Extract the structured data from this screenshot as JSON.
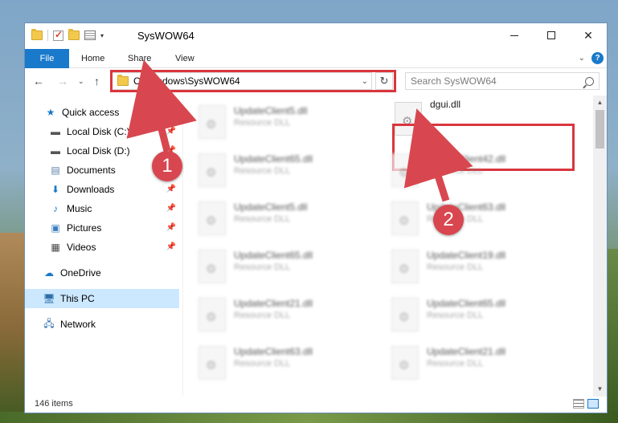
{
  "window": {
    "title": "SysWOW64"
  },
  "ribbon": {
    "tabs": [
      "File",
      "Home",
      "Share",
      "View"
    ]
  },
  "navigation": {
    "address": "C:\\Windows\\SysWOW64",
    "search_placeholder": "Search SysWOW64"
  },
  "sidebar": {
    "items": [
      {
        "label": "Quick access",
        "icon": "star-icon",
        "pinned": false
      },
      {
        "label": "Local Disk (C:)",
        "icon": "drive-icon",
        "pinned": true
      },
      {
        "label": "Local Disk (D:)",
        "icon": "drive-icon",
        "pinned": true
      },
      {
        "label": "Documents",
        "icon": "documents-icon",
        "pinned": true
      },
      {
        "label": "Downloads",
        "icon": "downloads-icon",
        "pinned": true
      },
      {
        "label": "Music",
        "icon": "music-icon",
        "pinned": true
      },
      {
        "label": "Pictures",
        "icon": "pictures-icon",
        "pinned": true
      },
      {
        "label": "Videos",
        "icon": "videos-icon",
        "pinned": true
      },
      {
        "label": "OneDrive",
        "icon": "onedrive-icon",
        "pinned": false
      },
      {
        "label": "This PC",
        "icon": "this-pc-icon",
        "pinned": false,
        "selected": true
      },
      {
        "label": "Network",
        "icon": "network-icon",
        "pinned": false
      }
    ]
  },
  "files": {
    "left_column": [
      {
        "name": "UpdateClient5.dll",
        "type": "Resource DLL"
      },
      {
        "name": "UpdateClient65.dll",
        "type": "Resource DLL"
      },
      {
        "name": "UpdateClient5.dll",
        "type": "Resource DLL"
      },
      {
        "name": "UpdateClient65.dll",
        "type": "Resource DLL"
      },
      {
        "name": "UpdateClient21.dll",
        "type": "Resource DLL"
      },
      {
        "name": "UpdateClient63.dll",
        "type": "Resource DLL"
      }
    ],
    "highlighted": {
      "name": "dgui.dll",
      "type": ""
    },
    "right_column": [
      {
        "name": "UpdateClient42.dll",
        "type": "Resource DLL"
      },
      {
        "name": "UpdateClient63.dll",
        "type": "Resource DLL"
      },
      {
        "name": "UpdateClient19.dll",
        "type": "Resource DLL"
      },
      {
        "name": "UpdateClient65.dll",
        "type": "Resource DLL"
      },
      {
        "name": "UpdateClient21.dll",
        "type": "Resource DLL"
      }
    ]
  },
  "status": {
    "item_count": "146 items"
  },
  "callouts": {
    "step1": "1",
    "step2": "2"
  },
  "colors": {
    "accent": "#1979ca",
    "highlight_red": "#d9363e",
    "selection": "#cce8ff"
  }
}
